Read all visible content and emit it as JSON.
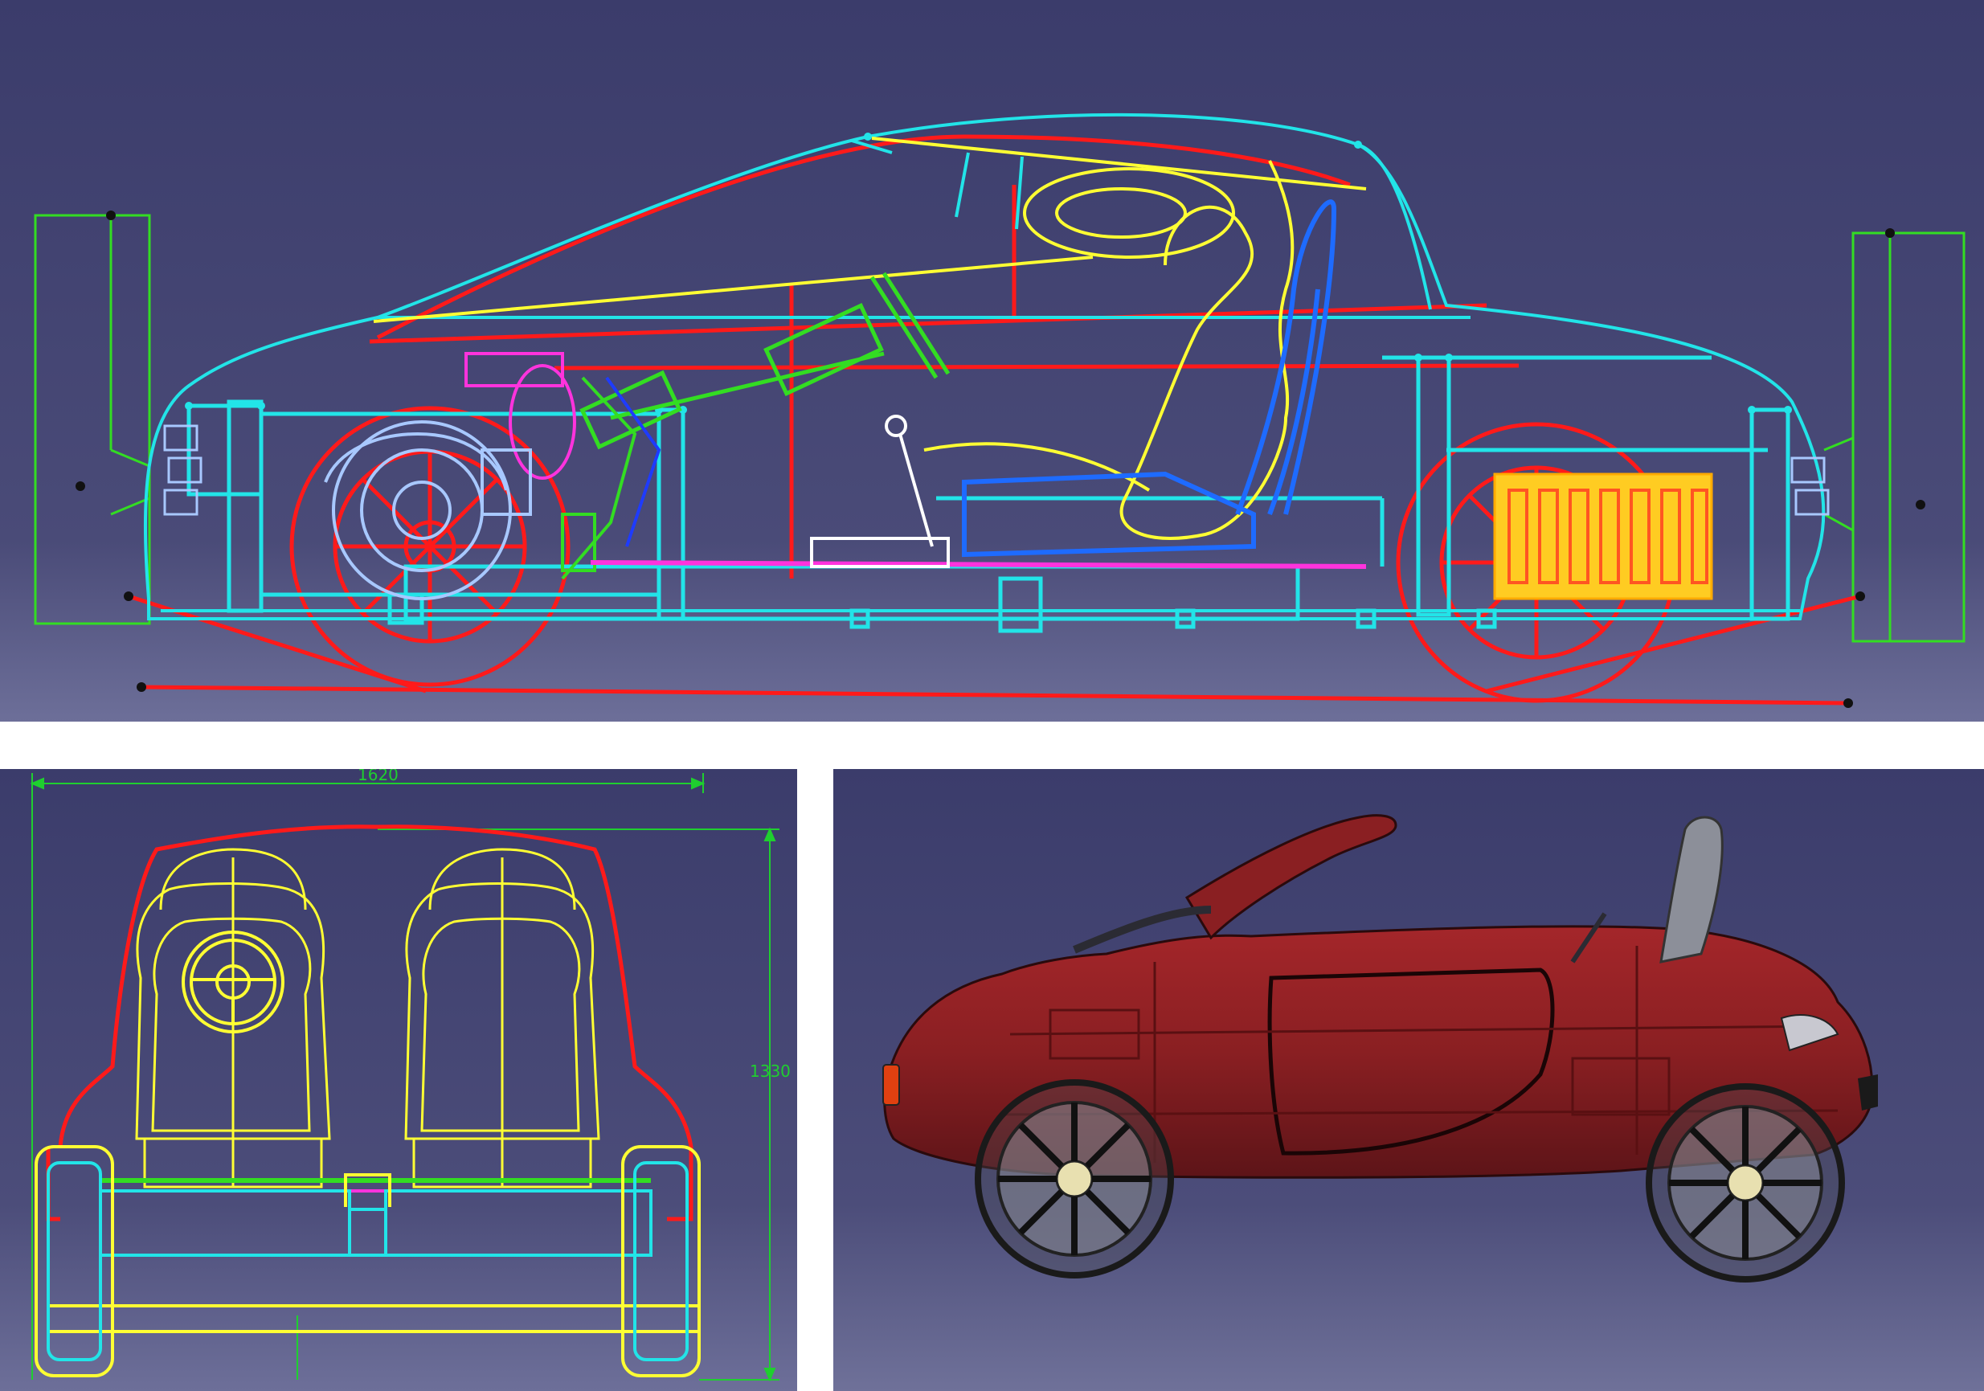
{
  "colors": {
    "background_top": "#3b3c6b",
    "background_bottom": "#6d6f99",
    "frame": "#22e4e8",
    "body_outline": "#ff1a1a",
    "seat": "#ffff33",
    "seat_blue": "#1e6bff",
    "steering": "#33dd22",
    "engine": "#a8c8ff",
    "battery": "#ffcc22",
    "dimension": "#1fcf2f",
    "render_body": "#8a1f22"
  },
  "front_view": {
    "width_dimension": "1620",
    "height_dimension": "1330"
  }
}
